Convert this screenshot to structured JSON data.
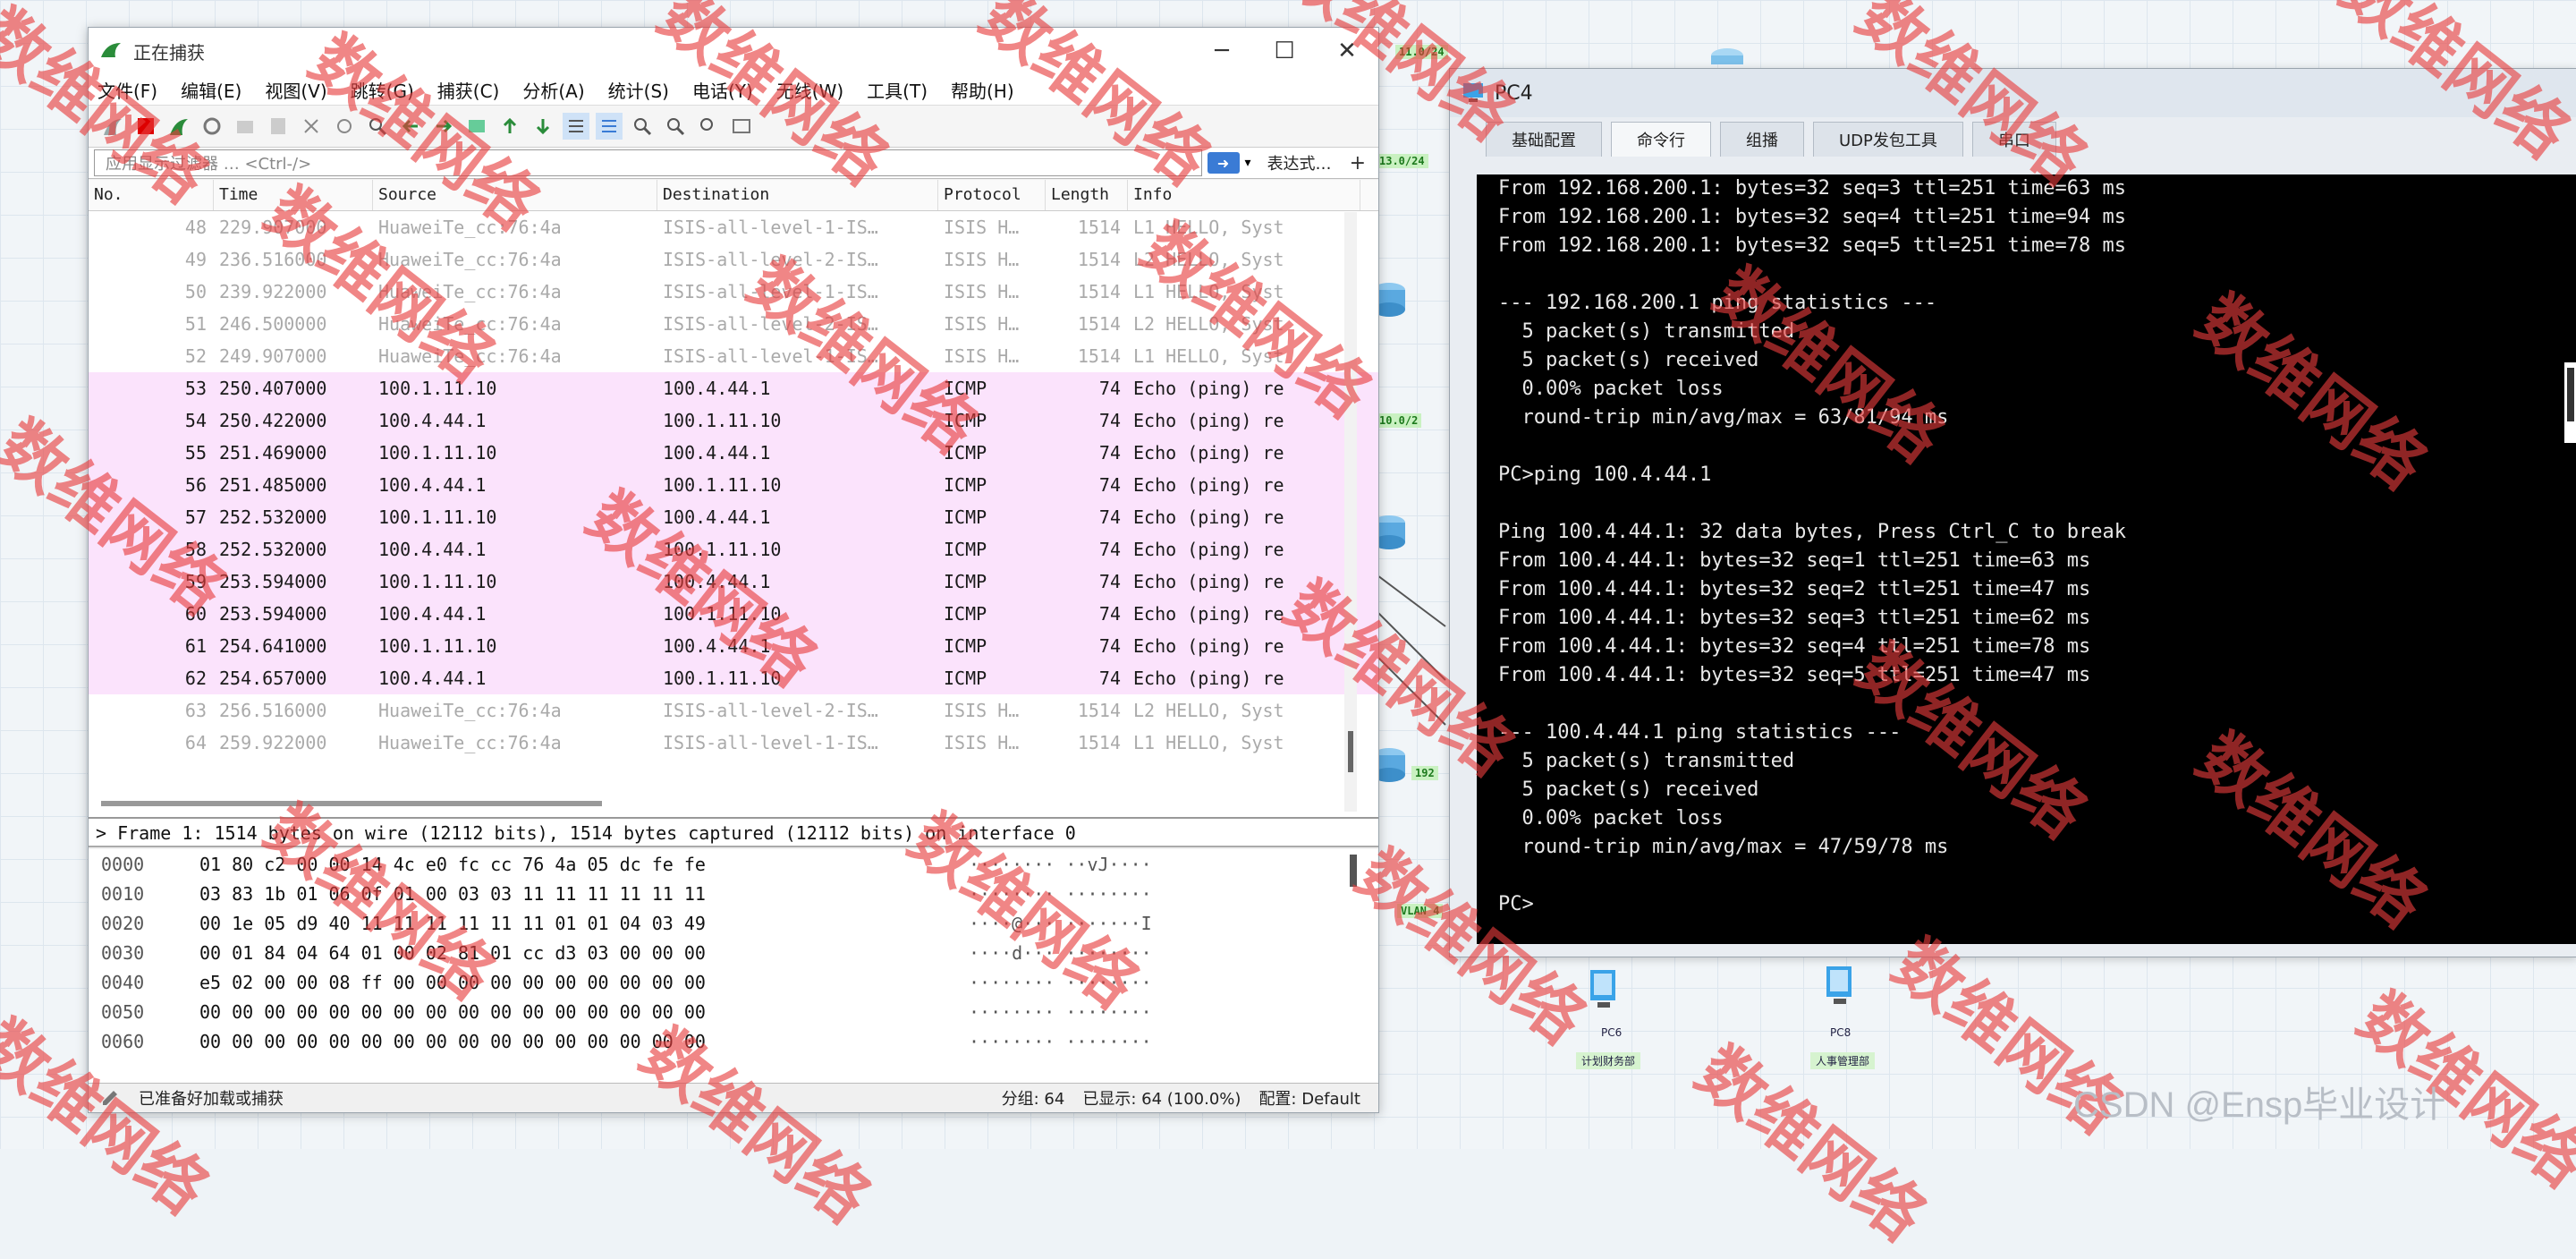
{
  "wireshark": {
    "title": "正在捕获",
    "menu": [
      "文件(F)",
      "编辑(E)",
      "视图(V)",
      "跳转(G)",
      "捕获(C)",
      "分析(A)",
      "统计(S)",
      "电话(Y)",
      "无线(W)",
      "工具(T)",
      "帮助(H)"
    ],
    "filter_placeholder": "应用显示过滤器 … <Ctrl-/>",
    "expression_label": "表达式…",
    "plus": "+",
    "columns": {
      "no": "No.",
      "time": "Time",
      "source": "Source",
      "destination": "Destination",
      "protocol": "Protocol",
      "length": "Length",
      "info": "Info"
    },
    "packets": [
      {
        "no": "48",
        "time": "229.907000",
        "source": "HuaweiTe_cc:76:4a",
        "destination": "ISIS-all-level-1-IS…",
        "protocol": "ISIS H…",
        "length": "1514",
        "info": "L1 HELLO, Syst",
        "type": "isis"
      },
      {
        "no": "49",
        "time": "236.516000",
        "source": "HuaweiTe_cc:76:4a",
        "destination": "ISIS-all-level-2-IS…",
        "protocol": "ISIS H…",
        "length": "1514",
        "info": "L2 HELLO, Syst",
        "type": "isis"
      },
      {
        "no": "50",
        "time": "239.922000",
        "source": "HuaweiTe_cc:76:4a",
        "destination": "ISIS-all-level-1-IS…",
        "protocol": "ISIS H…",
        "length": "1514",
        "info": "L1 HELLO, Syst",
        "type": "isis"
      },
      {
        "no": "51",
        "time": "246.500000",
        "source": "HuaweiTe_cc:76:4a",
        "destination": "ISIS-all-level-2-IS…",
        "protocol": "ISIS H…",
        "length": "1514",
        "info": "L2 HELLO, Syst",
        "type": "isis"
      },
      {
        "no": "52",
        "time": "249.907000",
        "source": "HuaweiTe_cc:76:4a",
        "destination": "ISIS-all-level-1-IS…",
        "protocol": "ISIS H…",
        "length": "1514",
        "info": "L1 HELLO, Syst",
        "type": "isis"
      },
      {
        "no": "53",
        "time": "250.407000",
        "source": "100.1.11.10",
        "destination": "100.4.44.1",
        "protocol": "ICMP",
        "length": "74",
        "info": "Echo (ping) re",
        "type": "icmp"
      },
      {
        "no": "54",
        "time": "250.422000",
        "source": "100.4.44.1",
        "destination": "100.1.11.10",
        "protocol": "ICMP",
        "length": "74",
        "info": "Echo (ping) re",
        "type": "icmp"
      },
      {
        "no": "55",
        "time": "251.469000",
        "source": "100.1.11.10",
        "destination": "100.4.44.1",
        "protocol": "ICMP",
        "length": "74",
        "info": "Echo (ping) re",
        "type": "icmp"
      },
      {
        "no": "56",
        "time": "251.485000",
        "source": "100.4.44.1",
        "destination": "100.1.11.10",
        "protocol": "ICMP",
        "length": "74",
        "info": "Echo (ping) re",
        "type": "icmp"
      },
      {
        "no": "57",
        "time": "252.532000",
        "source": "100.1.11.10",
        "destination": "100.4.44.1",
        "protocol": "ICMP",
        "length": "74",
        "info": "Echo (ping) re",
        "type": "icmp"
      },
      {
        "no": "58",
        "time": "252.532000",
        "source": "100.4.44.1",
        "destination": "100.1.11.10",
        "protocol": "ICMP",
        "length": "74",
        "info": "Echo (ping) re",
        "type": "icmp"
      },
      {
        "no": "59",
        "time": "253.594000",
        "source": "100.1.11.10",
        "destination": "100.4.44.1",
        "protocol": "ICMP",
        "length": "74",
        "info": "Echo (ping) re",
        "type": "icmp"
      },
      {
        "no": "60",
        "time": "253.594000",
        "source": "100.4.44.1",
        "destination": "100.1.11.10",
        "protocol": "ICMP",
        "length": "74",
        "info": "Echo (ping) re",
        "type": "icmp"
      },
      {
        "no": "61",
        "time": "254.641000",
        "source": "100.1.11.10",
        "destination": "100.4.44.1",
        "protocol": "ICMP",
        "length": "74",
        "info": "Echo (ping) re",
        "type": "icmp"
      },
      {
        "no": "62",
        "time": "254.657000",
        "source": "100.4.44.1",
        "destination": "100.1.11.10",
        "protocol": "ICMP",
        "length": "74",
        "info": "Echo (ping) re",
        "type": "icmp"
      },
      {
        "no": "63",
        "time": "256.516000",
        "source": "HuaweiTe_cc:76:4a",
        "destination": "ISIS-all-level-2-IS…",
        "protocol": "ISIS H…",
        "length": "1514",
        "info": "L2 HELLO, Syst",
        "type": "isis"
      },
      {
        "no": "64",
        "time": "259.922000",
        "source": "HuaweiTe_cc:76:4a",
        "destination": "ISIS-all-level-1-IS…",
        "protocol": "ISIS H…",
        "length": "1514",
        "info": "L1 HELLO, Syst",
        "type": "isis"
      }
    ],
    "detail": "> Frame 1: 1514 bytes on wire (12112 bits), 1514 bytes captured (12112 bits) on interface 0",
    "hex": [
      {
        "off": "0000",
        "bytes": "01 80 c2 00 00 14 4c e0  fc cc 76 4a 05 dc fe fe",
        "ascii": "········  ··vJ····"
      },
      {
        "off": "0010",
        "bytes": "03 83 1b 01 06 0f 01 00  03 03 11 11 11 11 11 11",
        "ascii": "········  ········"
      },
      {
        "off": "0020",
        "bytes": "00 1e 05 d9 40 11 11 11  11 11 11 01 01 04 03 49",
        "ascii": "····@···  ·······I"
      },
      {
        "off": "0030",
        "bytes": "00 01 84 04 64 01 00 02  81 01 cc d3 03 00 00 00",
        "ascii": "····d···  ········"
      },
      {
        "off": "0040",
        "bytes": "e5 02 00 00 08 ff 00 00  00 00 00 00 00 00 00 00",
        "ascii": "········  ········"
      },
      {
        "off": "0050",
        "bytes": "00 00 00 00 00 00 00 00  00 00 00 00 00 00 00 00",
        "ascii": "········  ········"
      },
      {
        "off": "0060",
        "bytes": "00 00 00 00 00 00 00 00  00 00 00 00 00 00 00 00",
        "ascii": "········  ········"
      }
    ],
    "status_ready": "已准备好加载或捕获",
    "status_packets": "分组: 64",
    "status_displayed": "已显示: 64 (100.0%)",
    "status_profile": "配置: Default"
  },
  "pc": {
    "title": "PC4",
    "tabs": [
      "基础配置",
      "命令行",
      "组播",
      "UDP发包工具",
      "串口"
    ],
    "active_tab": "命令行",
    "terminal": [
      "From 192.168.200.1: bytes=32 seq=3 ttl=251 time=63 ms",
      "From 192.168.200.1: bytes=32 seq=4 ttl=251 time=94 ms",
      "From 192.168.200.1: bytes=32 seq=5 ttl=251 time=78 ms",
      "",
      "--- 192.168.200.1 ping statistics ---",
      "  5 packet(s) transmitted",
      "  5 packet(s) received",
      "  0.00% packet loss",
      "  round-trip min/avg/max = 63/81/94 ms",
      "",
      "PC>ping 100.4.44.1",
      "",
      "Ping 100.4.44.1: 32 data bytes, Press Ctrl_C to break",
      "From 100.4.44.1: bytes=32 seq=1 ttl=251 time=63 ms",
      "From 100.4.44.1: bytes=32 seq=2 ttl=251 time=47 ms",
      "From 100.4.44.1: bytes=32 seq=3 ttl=251 time=62 ms",
      "From 100.4.44.1: bytes=32 seq=4 ttl=251 time=78 ms",
      "From 100.4.44.1: bytes=32 seq=5 ttl=251 time=47 ms",
      "",
      "--- 100.4.44.1 ping statistics ---",
      "  5 packet(s) transmitted",
      "  5 packet(s) received",
      "  0.00% packet loss",
      "  round-trip min/avg/max = 47/59/78 ms",
      "",
      "PC>"
    ]
  },
  "topology": {
    "tags": [
      "11.0/24",
      "13.0/24",
      "10.0/2",
      "192",
      "VLAN 4"
    ],
    "pc_labels": [
      "PC6",
      "PC8"
    ],
    "dept_labels": [
      "计划财务部",
      "人事管理部"
    ]
  },
  "watermark": "数维网络",
  "credit": "CSDN @Ensp毕业设计",
  "colors": {
    "icmp_row": "#fbe3fc",
    "terminal_bg": "#000000",
    "watermark": "#e63c3c"
  }
}
